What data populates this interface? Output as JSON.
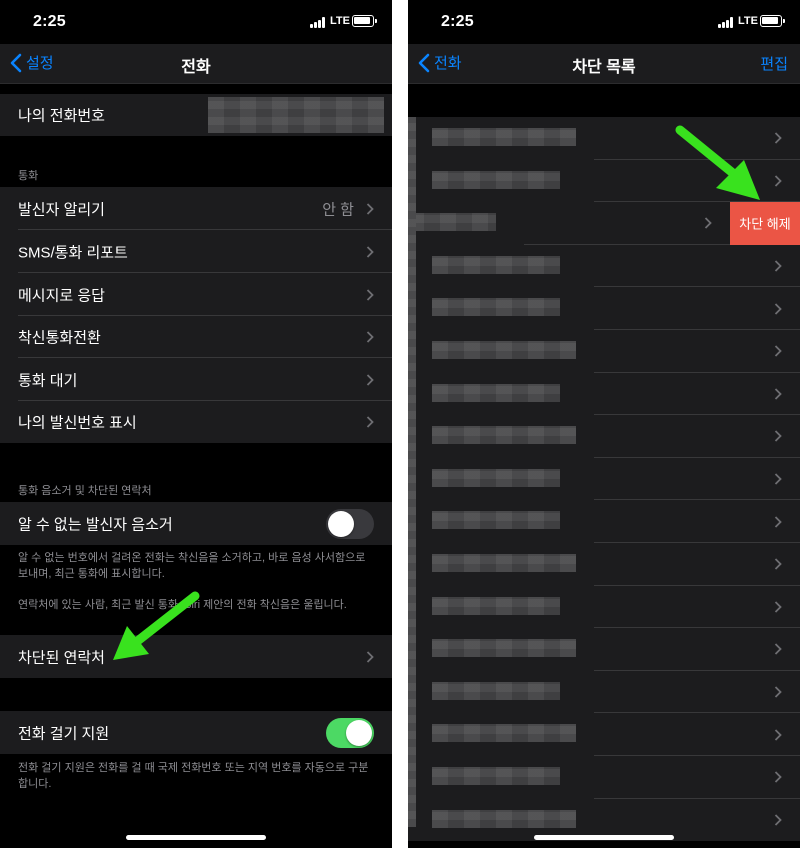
{
  "left": {
    "status": {
      "time": "2:25",
      "network": "LTE"
    },
    "nav": {
      "back_label": "설정",
      "title": "전화"
    },
    "my_number_label": "나의 전화번호",
    "section_calls": {
      "header": "통화",
      "items": [
        {
          "label": "발신자 알리기",
          "value": "안 함"
        },
        {
          "label": "SMS/통화 리포트"
        },
        {
          "label": "메시지로 응답"
        },
        {
          "label": "착신통화전환"
        },
        {
          "label": "통화 대기"
        },
        {
          "label": "나의 발신번호 표시"
        }
      ]
    },
    "section_silence": {
      "header": "통화 음소거 및 차단된 연락처",
      "silence_label": "알 수 없는 발신자 음소거",
      "silence_enabled": false,
      "footer1": "알 수 없는 번호에서 걸려온 전화는 착신음을 소거하고, 바로 음성 사서함으로 보내며, 최근 통화에 표시합니다.",
      "footer2": "연락처에 있는 사람, 최근 발신 통화, Siri 제안의 전화 착신음은 울립니다.",
      "blocked_label": "차단된 연락처"
    },
    "section_dial": {
      "label": "전화 걸기 지원",
      "enabled": true,
      "footer": "전화 걸기 지원은 전화를 걸 때 국제 전화번호 또는 지역 번호를 자동으로 구분합니다."
    }
  },
  "right": {
    "status": {
      "time": "2:25",
      "network": "LTE"
    },
    "nav": {
      "back_label": "전화",
      "title": "차단 목록",
      "action_label": "편집"
    },
    "unblock_label": "차단 해제"
  },
  "colors": {
    "accent": "#0a84ff",
    "toggle_on": "#4cd964",
    "unblock": "#eb5545",
    "arrow": "#39e21e"
  },
  "icons": {
    "chevron": "chevron-right-icon",
    "back": "chevron-left-icon",
    "arrow": "pointer-arrow"
  }
}
